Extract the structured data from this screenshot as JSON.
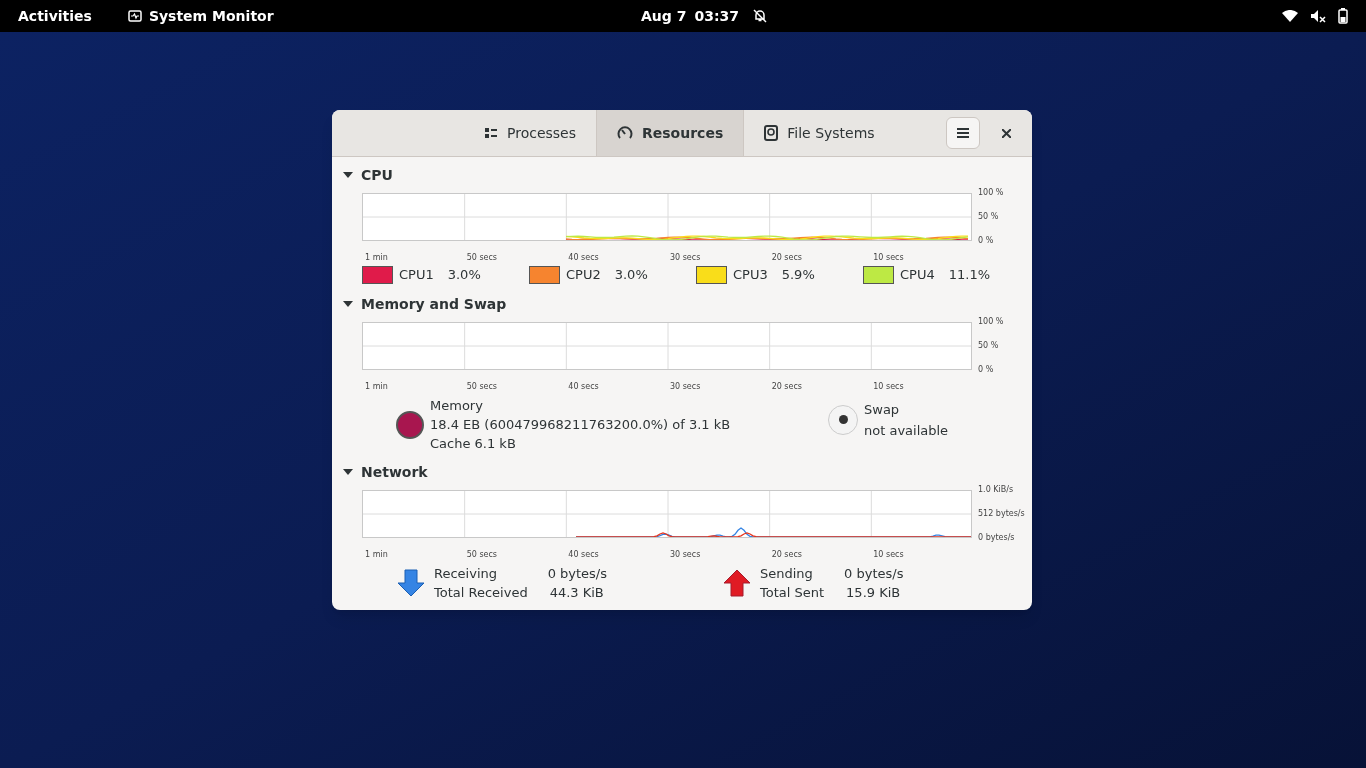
{
  "top_bar": {
    "activities": "Activities",
    "app_name": "System Monitor",
    "date": "Aug 7",
    "time": "03:37"
  },
  "window": {
    "tabs": [
      {
        "label": "Processes",
        "selected": false
      },
      {
        "label": "Resources",
        "selected": true
      },
      {
        "label": "File Systems",
        "selected": false
      }
    ]
  },
  "sections": [
    {
      "kind": "cpu",
      "title": "CPU",
      "expanded": true,
      "x_labels": [
        "1 min",
        "50 secs",
        "40 secs",
        "30 secs",
        "20 secs",
        "10 secs"
      ],
      "y_labels": [
        "100 %",
        "50 %",
        "0 %"
      ],
      "cpus": [
        {
          "name": "CPU1",
          "value": "3.0%",
          "color": "#e01b4a"
        },
        {
          "name": "CPU2",
          "value": "3.0%",
          "color": "#f6842f"
        },
        {
          "name": "CPU3",
          "value": "5.9%",
          "color": "#f9dd1a"
        },
        {
          "name": "CPU4",
          "value": "11.1%",
          "color": "#bde944"
        }
      ]
    },
    {
      "kind": "memory",
      "title": "Memory and Swap",
      "expanded": true,
      "x_labels": [
        "1 min",
        "50 secs",
        "40 secs",
        "30 secs",
        "20 secs",
        "10 secs"
      ],
      "y_labels": [
        "100 %",
        "50 %",
        "0 %"
      ],
      "memory": {
        "label": "Memory",
        "usage": "18.4 EB (600479968211763200.0%) of 3.1 kB",
        "cache": "Cache 6.1 kB",
        "color": "#a8164f"
      },
      "swap": {
        "label": "Swap",
        "status": "not available"
      }
    },
    {
      "kind": "network",
      "title": "Network",
      "expanded": true,
      "x_labels": [
        "1 min",
        "50 secs",
        "40 secs",
        "30 secs",
        "20 secs",
        "10 secs"
      ],
      "y_labels": [
        "1.0 KiB/s",
        "512 bytes/s",
        "0 bytes/s"
      ],
      "receiving": {
        "label": "Receiving",
        "rate": "0 bytes/s",
        "total_label": "Total Received",
        "total": "44.3 KiB"
      },
      "sending": {
        "label": "Sending",
        "rate": "0 bytes/s",
        "total_label": "Total Sent",
        "total": "15.9 KiB"
      }
    }
  ]
}
